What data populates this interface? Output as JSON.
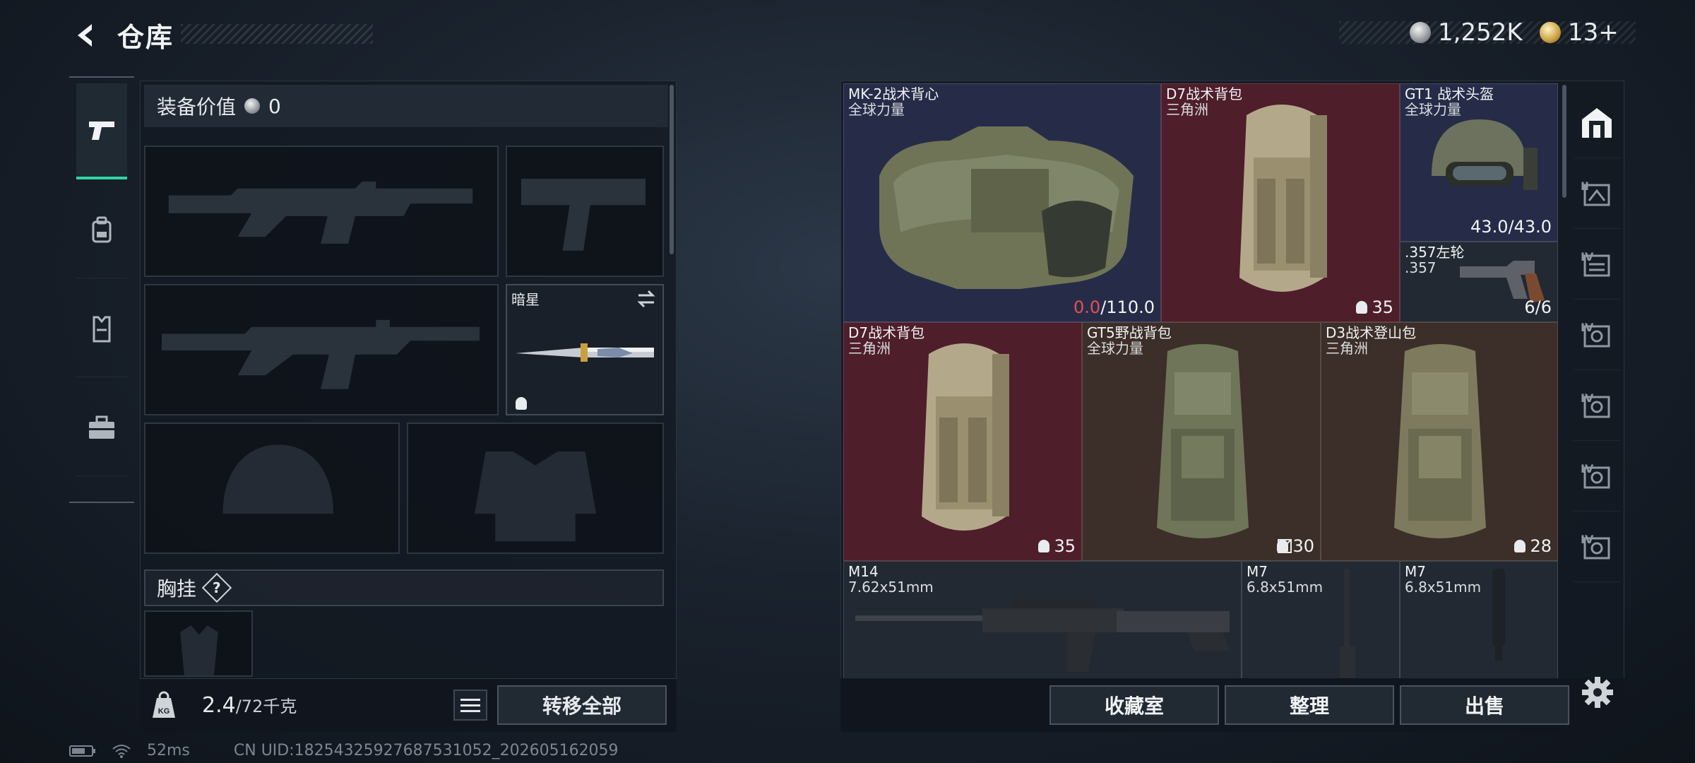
{
  "header": {
    "title": "仓库",
    "currency": [
      {
        "icon": "silver-coin-icon",
        "value": "1,252K"
      },
      {
        "icon": "gold-coin-icon",
        "value": "13+"
      }
    ]
  },
  "left_tabs": [
    {
      "name": "weapons",
      "icon": "pistol-icon",
      "active": true
    },
    {
      "name": "backpack",
      "icon": "backpack-icon"
    },
    {
      "name": "vest",
      "icon": "vest-icon"
    },
    {
      "name": "case",
      "icon": "briefcase-icon"
    }
  ],
  "loadout": {
    "value_label": "装备价值",
    "value": "0",
    "melee": {
      "name": "暗星"
    },
    "chest_rig_label": "胸挂",
    "help": "?",
    "weight": "2.4",
    "weight_max": "/72千克",
    "transfer_all": "转移全部"
  },
  "status": {
    "ping": "52ms",
    "uid": "CN UID:18254325927687531052_202605162059"
  },
  "items": [
    {
      "name": "MK-2战术背心",
      "sub": "全球力量",
      "value": "/110.0",
      "value_red": "0.0",
      "bg": "purple",
      "icon": "armor-vest-icon"
    },
    {
      "name": "D7战术背包",
      "sub": "三角洲",
      "value": "35",
      "bg": "red",
      "icon": "backpack-icon"
    },
    {
      "name": "GT1 战术头盔",
      "sub": "全球力量",
      "value": "43.0/43.0",
      "bg": "purple",
      "icon": "helmet-icon"
    },
    {
      "name": ".357左轮",
      "sub": ".357",
      "value": "6/6",
      "bg": "gray",
      "icon": "revolver-icon"
    },
    {
      "name": "D7战术背包",
      "sub": "三角洲",
      "value": "35",
      "bg": "red",
      "icon": "backpack-icon"
    },
    {
      "name": "GT5野战背包",
      "sub": "全球力量",
      "value": "30",
      "bg": "brown",
      "icon": "backpack-icon"
    },
    {
      "name": "D3战术登山包",
      "sub": "三角洲",
      "value": "28",
      "bg": "brown",
      "icon": "backpack-icon"
    },
    {
      "name": "M14",
      "sub": "7.62x51mm",
      "value": "",
      "bg": "gray",
      "icon": "rifle-icon"
    },
    {
      "name": "M7",
      "sub": "6.8x51mm",
      "value": "",
      "bg": "gray",
      "icon": "suppressor-icon"
    },
    {
      "name": "M7",
      "sub": "6.8x51mm",
      "value": "",
      "bg": "gray",
      "icon": "suppressor-icon"
    }
  ],
  "right_tabs": [
    {
      "icon": "home-storage-icon",
      "active": true
    },
    {
      "icon": "storage-ii-icon",
      "level": "II"
    },
    {
      "icon": "storage-iv-icon",
      "level": "IV"
    },
    {
      "icon": "storage-iv-icon",
      "level": "IV"
    },
    {
      "icon": "storage-iv-icon",
      "level": "IV"
    },
    {
      "icon": "storage-iv-icon",
      "level": "IV"
    },
    {
      "icon": "storage-iv-icon",
      "level": "IV"
    }
  ],
  "buttons": {
    "collection": "收藏室",
    "organize": "整理",
    "sell": "出售"
  },
  "colors": {
    "accent": "#2fd6a2",
    "purple": "#262c48",
    "red": "#4e1e2a",
    "brown": "#3c2e28",
    "warning": "#e05252"
  }
}
